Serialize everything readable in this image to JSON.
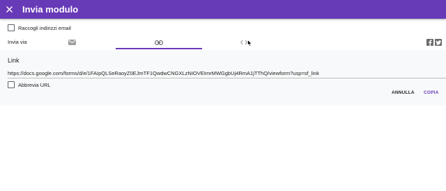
{
  "dialog": {
    "title": "Invia modulo",
    "accent_color": "#673ab7"
  },
  "collect_email": {
    "label": "Raccogli indirizzi email",
    "checked": false
  },
  "send_via": {
    "label": "Invia via",
    "tabs": [
      {
        "icon": "email-icon",
        "selected": false
      },
      {
        "icon": "link-icon",
        "selected": true
      },
      {
        "icon": "embed-icon",
        "selected": false
      }
    ],
    "social": [
      {
        "icon": "facebook-icon"
      },
      {
        "icon": "twitter-icon"
      }
    ]
  },
  "link_panel": {
    "heading": "Link",
    "url": "https://docs.google.com/forms/d/e/1FAIpQLSeRaoyZ0EJmTF1QwdwCNGXLzNIOVEImrMWGgbUj4RmA1jTThQ/viewform?usp=sf_link",
    "shorten": {
      "label": "Abbrevia URL",
      "checked": false
    },
    "cancel_label": "ANNULLA",
    "copy_label": "COPIA"
  }
}
